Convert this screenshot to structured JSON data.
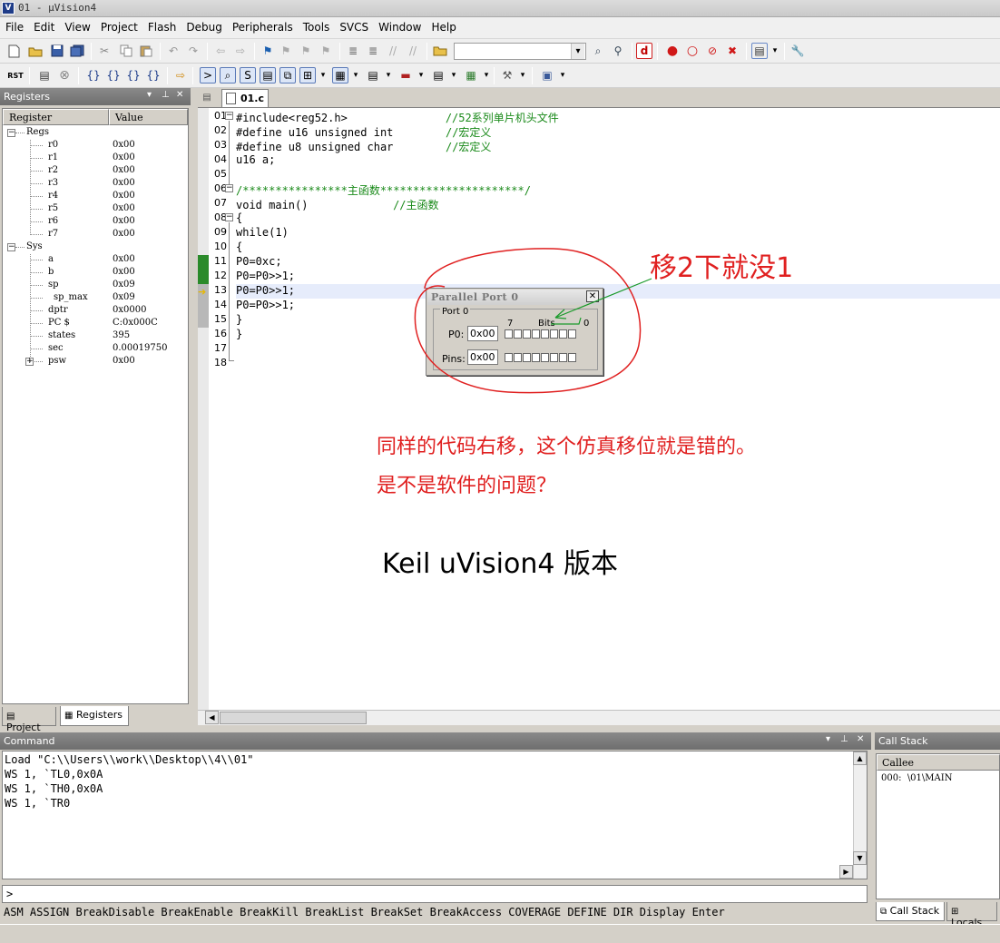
{
  "window": {
    "title": "01 - µVision4"
  },
  "menu": [
    "File",
    "Edit",
    "View",
    "Project",
    "Flash",
    "Debug",
    "Peripherals",
    "Tools",
    "SVCS",
    "Window",
    "Help"
  ],
  "registers_panel": {
    "title": "Registers",
    "columns": [
      "Register",
      "Value"
    ],
    "groups": [
      {
        "name": "Regs",
        "items": [
          {
            "name": "r0",
            "value": "0x00"
          },
          {
            "name": "r1",
            "value": "0x00"
          },
          {
            "name": "r2",
            "value": "0x00"
          },
          {
            "name": "r3",
            "value": "0x00"
          },
          {
            "name": "r4",
            "value": "0x00"
          },
          {
            "name": "r5",
            "value": "0x00"
          },
          {
            "name": "r6",
            "value": "0x00"
          },
          {
            "name": "r7",
            "value": "0x00"
          }
        ]
      },
      {
        "name": "Sys",
        "items": [
          {
            "name": "a",
            "value": "0x00"
          },
          {
            "name": "b",
            "value": "0x00"
          },
          {
            "name": "sp",
            "value": "0x09"
          },
          {
            "name": "sp_max",
            "value": "0x09"
          },
          {
            "name": "dptr",
            "value": "0x0000"
          },
          {
            "name": "PC  $",
            "value": "C:0x000C"
          },
          {
            "name": "states",
            "value": "395"
          },
          {
            "name": "sec",
            "value": "0.00019750"
          },
          {
            "name": "psw",
            "value": "0x00"
          }
        ]
      }
    ],
    "tabs": [
      "Project",
      "Registers"
    ]
  },
  "editor": {
    "tab": "01.c",
    "lines": [
      {
        "no": "01",
        "code": "#include<reg52.h>",
        "comment": "//52系列单片机头文件"
      },
      {
        "no": "02",
        "code": "#define u16 unsigned int",
        "comment": "//宏定义"
      },
      {
        "no": "03",
        "code": "#define u8 unsigned char",
        "comment": "//宏定义"
      },
      {
        "no": "04",
        "code": "u16 a;",
        "comment": ""
      },
      {
        "no": "05",
        "code": "",
        "comment": ""
      },
      {
        "no": "06",
        "code": "",
        "comment": "/****************主函数**********************/"
      },
      {
        "no": "07",
        "code": "void main()",
        "comment": "//主函数"
      },
      {
        "no": "08",
        "code": "{",
        "comment": ""
      },
      {
        "no": "09",
        "code": "while(1)",
        "comment": ""
      },
      {
        "no": "10",
        "code": "{",
        "comment": ""
      },
      {
        "no": "11",
        "code": "P0=0xc;",
        "comment": ""
      },
      {
        "no": "12",
        "code": "P0=P0>>1;",
        "comment": ""
      },
      {
        "no": "13",
        "code": "P0=P0>>1;",
        "comment": ""
      },
      {
        "no": "14",
        "code": "P0=P0>>1;",
        "comment": ""
      },
      {
        "no": "15",
        "code": "}",
        "comment": ""
      },
      {
        "no": "16",
        "code": "}",
        "comment": ""
      },
      {
        "no": "17",
        "code": "",
        "comment": ""
      },
      {
        "no": "18",
        "code": "",
        "comment": ""
      }
    ],
    "current_line": "13"
  },
  "parallel_port_dialog": {
    "title": "Parallel Port 0",
    "group": "Port 0",
    "bits_high": "7",
    "bits_label": "Bits",
    "bits_low": "0",
    "p0_label": "P0:",
    "p0_value": "0x00",
    "pins_label": "Pins:",
    "pins_value": "0x00",
    "p0_bits": [
      0,
      0,
      0,
      0,
      0,
      0,
      0,
      0
    ],
    "pins_bits": [
      0,
      0,
      0,
      0,
      0,
      0,
      0,
      0
    ]
  },
  "annotations": {
    "arrow_note": "移2下就没1",
    "line1": "同样的代码右移，这个仿真移位就是错的。",
    "line2": "是不是软件的问题？",
    "version": "Keil uVision4 版本",
    "colors": {
      "red": "#e02020",
      "green": "#1a9a2a"
    }
  },
  "command_panel": {
    "title": "Command",
    "output": [
      "Load \"C:\\\\Users\\\\work\\\\Desktop\\\\4\\\\01\"",
      "WS 1, `TL0,0x0A",
      "WS 1, `TH0,0x0A",
      "WS 1, `TR0"
    ],
    "prompt": ">",
    "hint": "ASM ASSIGN BreakDisable BreakEnable BreakKill BreakList BreakSet BreakAccess COVERAGE DEFINE DIR Display Enter"
  },
  "callstack_panel": {
    "title": "Call Stack",
    "column": "Callee",
    "rows": [
      "000:  \\01\\MAIN"
    ],
    "tabs": [
      "Call Stack",
      "Locals"
    ]
  }
}
